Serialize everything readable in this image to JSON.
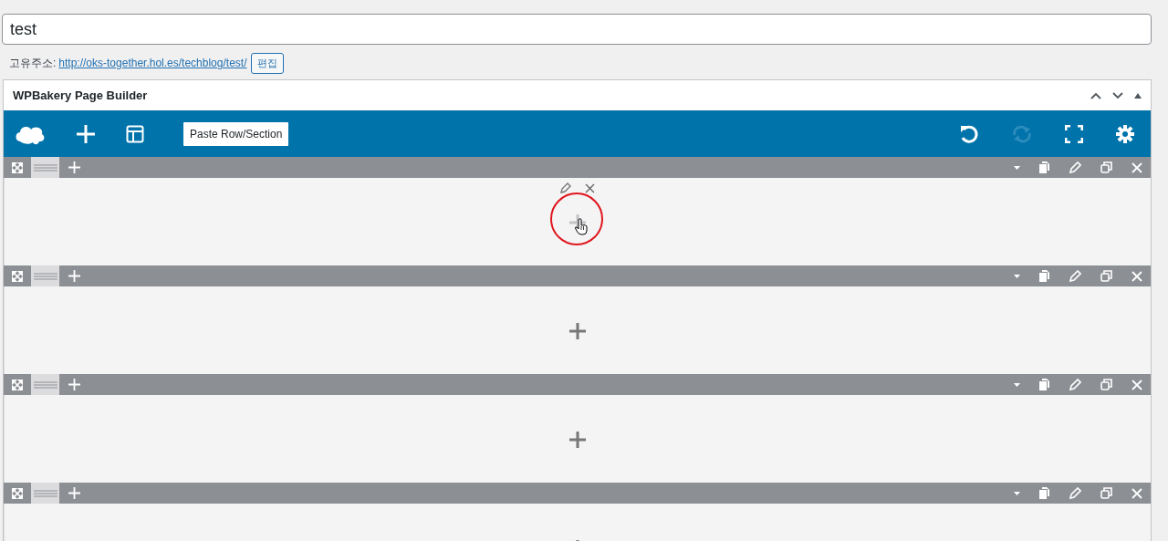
{
  "title_field": {
    "value": "test"
  },
  "permalink": {
    "label": "고유주소:",
    "url": "http://oks-together.hol.es/techblog/test/",
    "edit_button": "편집"
  },
  "panel": {
    "title": "WPBakery Page Builder",
    "collapsed": false
  },
  "toolbar": {
    "paste_button": "Paste Row/Section",
    "redo_disabled": true
  },
  "rows": [
    {
      "hovered": true,
      "circled": true
    },
    {
      "hovered": false,
      "circled": false
    },
    {
      "hovered": false,
      "circled": false
    },
    {
      "hovered": false,
      "circled": false
    }
  ]
}
